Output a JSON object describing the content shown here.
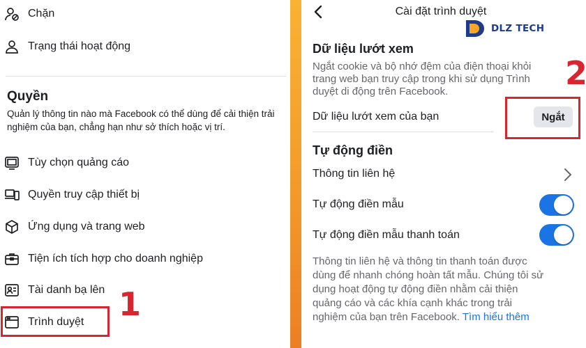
{
  "left": {
    "top_items": [
      {
        "label": "Chặn",
        "icon": "blocked-user-icon"
      },
      {
        "label": "Trạng thái hoạt động",
        "icon": "user-status-icon"
      }
    ],
    "section_title": "Quyền",
    "section_desc": "Quản lý thông tin nào mà Facebook có thể dùng để cải thiện trải nghiệm của bạn, chẳng hạn như sở thích hoặc vị trí.",
    "items": [
      {
        "label": "Tùy chọn quảng cáo",
        "icon": "ad-preferences-icon"
      },
      {
        "label": "Quyền truy cập thiết bị",
        "icon": "device-access-icon"
      },
      {
        "label": "Ứng dụng và trang web",
        "icon": "apps-websites-icon"
      },
      {
        "label": "Tiện ích tích hợp cho doanh nghiệp",
        "icon": "business-integrations-icon"
      },
      {
        "label": "Tài danh bạ lên",
        "icon": "contacts-upload-icon"
      },
      {
        "label": "Trình duyệt",
        "icon": "browser-icon"
      }
    ],
    "annotation": "1"
  },
  "right": {
    "nav_title": "Cài đặt trình duyệt",
    "browsing": {
      "title": "Dữ liệu lướt xem",
      "desc_lines": [
        "Ngắt cookie và bộ nhớ đệm của điện thoại khỏi",
        "trang web bạn truy cập trong khi sử dụng Trình",
        "duyệt di động trên Facebook."
      ],
      "row_label": "Dữ liệu lướt xem của bạn",
      "button_label": "Ngắt"
    },
    "autofill": {
      "title": "Tự động điền",
      "contact_label": "Thông tin liên hệ",
      "form_label": "Tự động điền mẫu",
      "form_on": true,
      "payment_label": "Tự động điền mẫu thanh toán",
      "payment_on": true,
      "desc_lines": [
        "Thông tin liên hệ và thông tin thanh toán được",
        "dùng để nhanh chóng hoàn tất mẫu. Chúng tôi sử",
        "dụng hoạt động tự động điền nhằm cải thiện",
        "quảng cáo và các khía cạnh khác trong trải"
      ],
      "desc_last_line": "nghiệm của bạn trên Facebook.",
      "learn_more": "Tìm hiểu thêm"
    },
    "annotation": "2",
    "logo_text": "DLZ TECH"
  },
  "colors": {
    "accent": "#1b74e4",
    "highlight": "#d7262f",
    "background": "#f39a2a"
  }
}
